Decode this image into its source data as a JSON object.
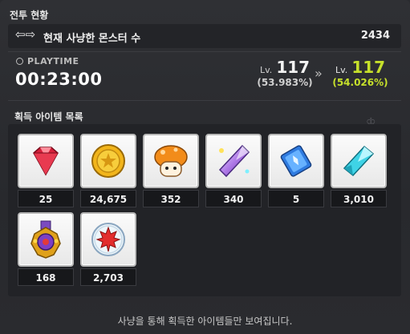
{
  "header": {
    "title": "전투 현황"
  },
  "kill_count": {
    "label": "현재 사냥한 몬스터 수",
    "value": "2434",
    "icon": "arrows-icon"
  },
  "playtime": {
    "label": "PLAYTIME",
    "value": "00:23:00",
    "icon": "clock-icon"
  },
  "level": {
    "from": {
      "prefix": "Lv.",
      "level": "117",
      "percent": "(53.983%)"
    },
    "to": {
      "prefix": "Lv.",
      "level": "117",
      "percent": "(54.026%)"
    },
    "accent_color": "#c6e02b"
  },
  "items": {
    "title": "획득 아이템 목록",
    "list": [
      {
        "icon": "red-gem-icon",
        "count": "25"
      },
      {
        "icon": "gold-coin-icon",
        "count": "24,675"
      },
      {
        "icon": "orange-mushroom-icon",
        "count": "352"
      },
      {
        "icon": "prism-crystal-icon",
        "count": "340"
      },
      {
        "icon": "blue-scroll-icon",
        "count": "5"
      },
      {
        "icon": "cyan-crystal-icon",
        "count": "3,010"
      },
      {
        "icon": "gold-medal-icon",
        "count": "168"
      },
      {
        "icon": "maple-leaf-orb-icon",
        "count": "2,703"
      }
    ]
  },
  "footer": {
    "note": "사냥을 통해 획득한 아이템들만 보여집니다."
  }
}
